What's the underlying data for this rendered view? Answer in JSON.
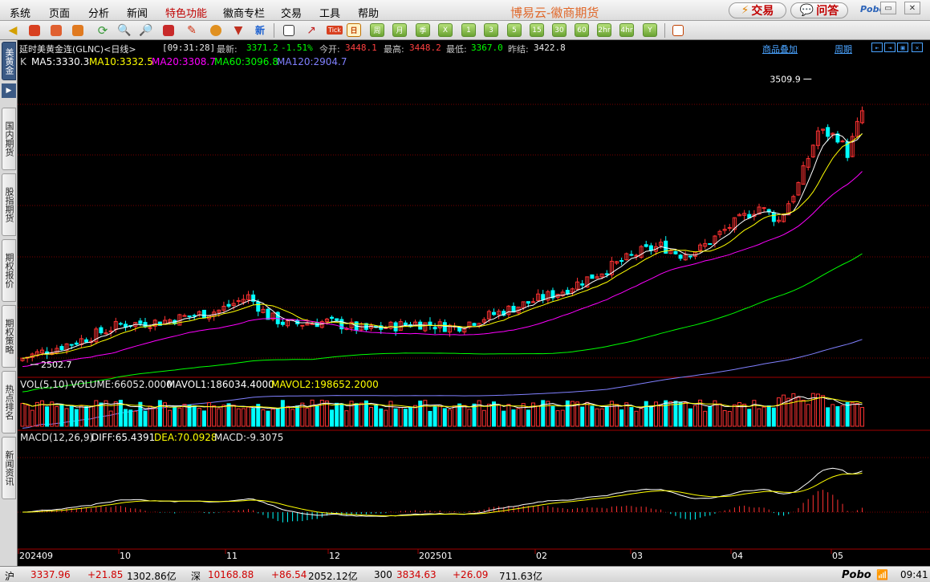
{
  "menu": {
    "items": [
      "系统",
      "页面",
      "分析",
      "新闻",
      "特色功能",
      "徽商专栏",
      "交易",
      "工具",
      "帮助"
    ],
    "highlight_index": 4,
    "app_title": "博易云-徽商期货",
    "trade_button": "交易",
    "qa_button": "问答",
    "top_logo": "Pobo"
  },
  "toolbar": {
    "icons": [
      "back-arrow-icon",
      "home-icon",
      "tick-icon",
      "f10-icon",
      "refresh-icon",
      "zoom-in-icon",
      "zoom-out-icon",
      "windows-icon",
      "pen-icon",
      "draw-line-icon",
      "filter-icon",
      "new-icon",
      "table-icon",
      "trend-icon",
      "tick-chart-icon"
    ],
    "periods": [
      "日",
      "周",
      "月",
      "季",
      "X",
      "1",
      "3",
      "5",
      "15",
      "30",
      "60",
      "2hr",
      "4hr",
      "Y"
    ],
    "selected_period": "日",
    "tick_label": "Tick",
    "new_label": "新"
  },
  "side_tabs": [
    "美黄金",
    "国内期货",
    "股指期货",
    "期权报价",
    "期权策略",
    "热点排名",
    "新闻资讯"
  ],
  "header": {
    "name": "延时美黄金连(GLNC)<日线>",
    "time": "[09:31:28]",
    "latest_label": "最新:",
    "latest": "3371.2",
    "change_pct": "-1.51%",
    "open_label": "今开:",
    "open": "3448.1",
    "high_label": "最高:",
    "high": "3448.2",
    "low_label": "最低:",
    "low": "3367.0",
    "prev_label": "昨结:",
    "prev": "3422.8",
    "overlay_link": "商品叠加",
    "period_link": "周期"
  },
  "ma": {
    "k": "K",
    "ma5": "MA5:3330.3",
    "ma10": "MA10:3332.5",
    "ma20": "MA20:3308.7",
    "ma60": "MA60:3096.8",
    "ma120": "MA120:2904.7",
    "colors": {
      "ma5": "#ffffff",
      "ma10": "#ffff00",
      "ma20": "#ff00ff",
      "ma60": "#00ff00",
      "ma120": "#8080ff"
    }
  },
  "volume": {
    "label": "VOL(5,10)",
    "volume": "VOLUME:66052.0000",
    "mavol1": "MAVOL1:186034.4000",
    "mavol2": "MAVOL2:198652.2000"
  },
  "macd": {
    "label": "MACD(12,26,9)",
    "diff": "DIFF:65.4391",
    "dea": "DEA:70.0928",
    "macd": "MACD:-9.3075"
  },
  "chart_data": {
    "type": "candlestick",
    "title": "延时美黄金连(GLNC)<日线>",
    "y_markers": {
      "high": 3509.9,
      "low": 2502.7
    },
    "x_labels": [
      "202409",
      "10",
      "11",
      "12",
      "202501",
      "02",
      "03",
      "04",
      "05"
    ],
    "up_color": "#ff3232",
    "down_color": "#00ffff"
  },
  "statusbar": {
    "sh_label": "沪",
    "sh_index": "3337.96",
    "sh_change": "+21.85",
    "sh_amount": "1302.86亿",
    "sz_label": "深",
    "sz_index": "10168.88",
    "sz_change": "+86.54",
    "sz_amount": "2052.12亿",
    "hs300_label": "300",
    "hs300_index": "3834.63",
    "hs300_change": "+26.09",
    "hs300_amount": "711.63亿",
    "logo": "Pobo",
    "clock": "09:41"
  }
}
